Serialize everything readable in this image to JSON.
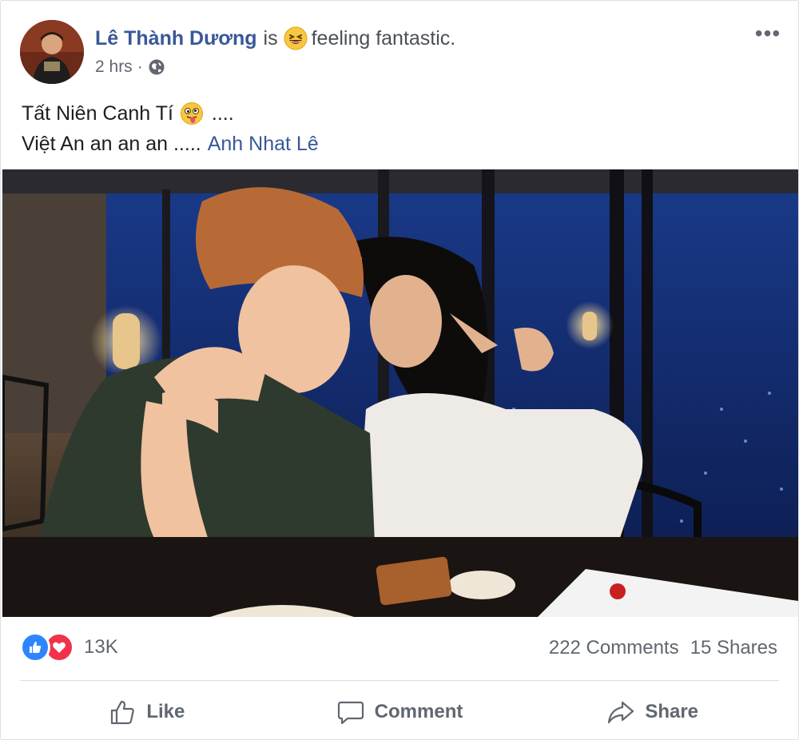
{
  "post": {
    "author": "Lê Thành Dương",
    "is_text": "is",
    "feeling_icon": "laughing-emoji-icon",
    "feeling": "feeling fantastic.",
    "time": "2 hrs",
    "dot": "·",
    "audience_icon": "globe-icon",
    "more_label": "•••",
    "text_line1": "Tất Niên Canh Tí",
    "text_line1_emoji": "tongue-out-emoji-icon",
    "text_line1_tail": "....",
    "text_line2": "Việt An an an an .....",
    "mention": "Anh Nhat Lê"
  },
  "stats": {
    "reaction_icons": [
      "like-reaction-icon",
      "love-reaction-icon"
    ],
    "reactions_count": "13K",
    "comments": "222 Comments",
    "shares": "15 Shares"
  },
  "actions": {
    "like": "Like",
    "comment": "Comment",
    "share": "Share"
  },
  "colors": {
    "link_blue": "#385898",
    "like_blue": "#2d86ff",
    "love_red": "#f0334b",
    "meta_grey": "#606770"
  }
}
